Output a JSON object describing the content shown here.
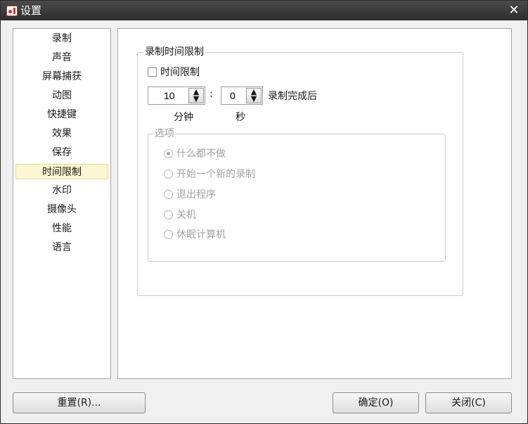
{
  "window": {
    "title": "设置"
  },
  "sidebar": {
    "items": [
      {
        "label": "录制"
      },
      {
        "label": "声音"
      },
      {
        "label": "屏幕捕获"
      },
      {
        "label": "动图"
      },
      {
        "label": "快捷键"
      },
      {
        "label": "效果"
      },
      {
        "label": "保存"
      },
      {
        "label": "时间限制",
        "selected": true
      },
      {
        "label": "水印"
      },
      {
        "label": "摄像头"
      },
      {
        "label": "性能"
      },
      {
        "label": "语言"
      }
    ]
  },
  "main": {
    "group_title": "录制时间限制",
    "time_limit_checkbox": {
      "label": "时间限制",
      "checked": false
    },
    "minutes": {
      "value": "10",
      "unit": "分钟"
    },
    "separator": ":",
    "seconds": {
      "value": "0",
      "unit": "秒"
    },
    "after_label": "录制完成后",
    "options": {
      "title": "选项",
      "items": [
        {
          "label": "什么都不做",
          "checked": true
        },
        {
          "label": "开始一个新的录制",
          "checked": false
        },
        {
          "label": "退出程序",
          "checked": false
        },
        {
          "label": "关机",
          "checked": false
        },
        {
          "label": "休眠计算机",
          "checked": false
        }
      ]
    }
  },
  "footer": {
    "reset_label": "重置(R)...",
    "ok_label": "确定(O)",
    "close_label": "关闭(C)"
  },
  "colors": {
    "titlebar": "#3a3a3a",
    "selected_item_bg": "#fcf6d4",
    "disabled_text": "#a3a3a3"
  },
  "icons": {
    "app": "recorder-app-icon",
    "close": "close-icon",
    "spin": "spin-up-down-icon"
  }
}
